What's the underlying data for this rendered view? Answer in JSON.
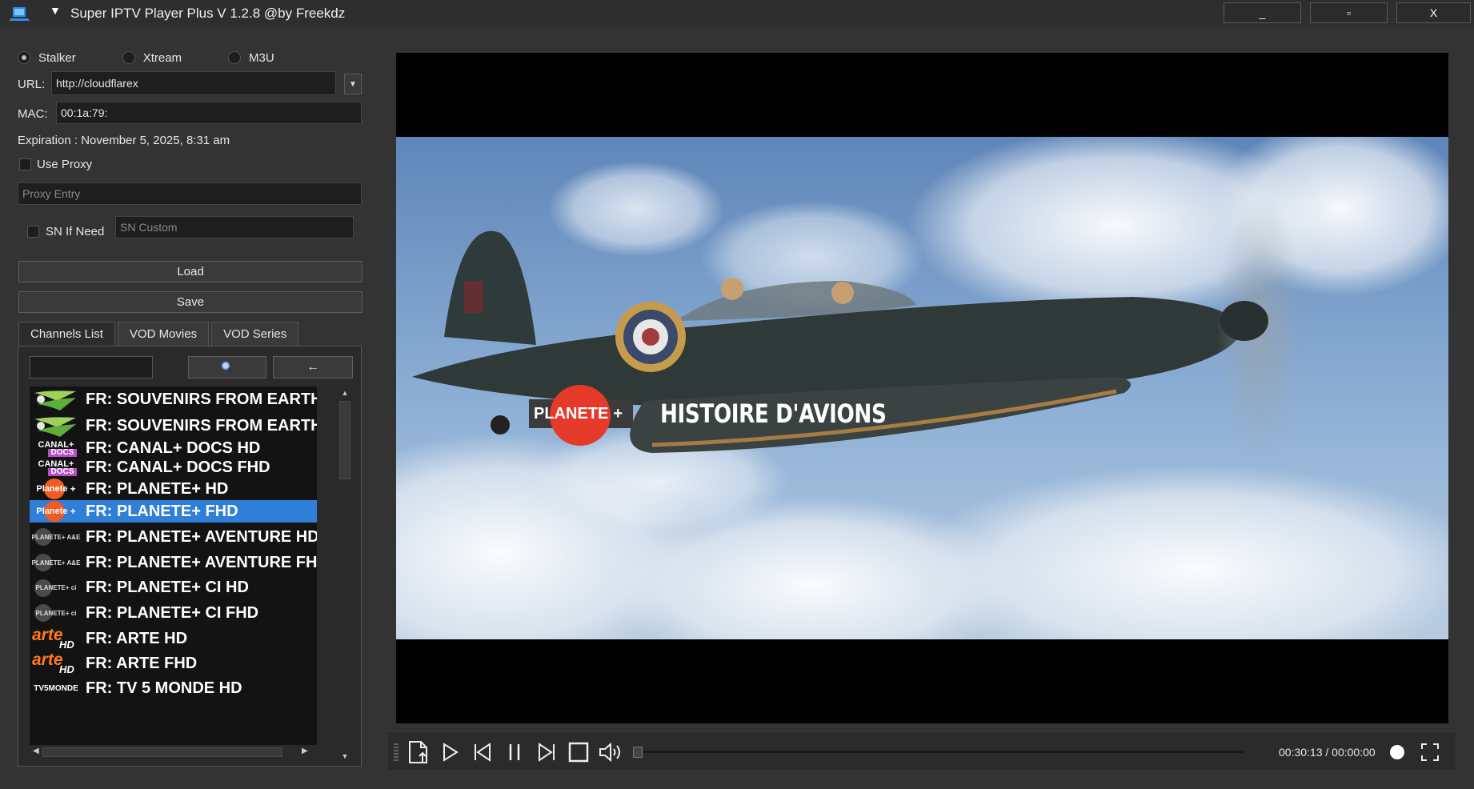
{
  "window": {
    "title": "Super IPTV Player Plus V 1.2.8 @by Freekdz",
    "minimize_label": "_",
    "maximize_label": "▫",
    "close_label": "X",
    "menu_icon": "menu-caret-icon",
    "app_icon": "laptop-icon"
  },
  "mode": {
    "options": [
      "Stalker",
      "Xtream",
      "M3U"
    ],
    "selected": "Stalker"
  },
  "connection": {
    "url_label": "URL:",
    "url_value": "http://cloudflarex",
    "mac_label": "MAC:",
    "mac_value": "00:1a:79:",
    "expiration": "Expiration : November 5, 2025, 8:31 am",
    "use_proxy_label": "Use Proxy",
    "proxy_placeholder": "Proxy Entry",
    "sn_label": "SN If Need",
    "sn_placeholder": "SN Custom"
  },
  "actions": {
    "load_label": "Load",
    "save_label": "Save"
  },
  "tabs": [
    "Channels List",
    "VOD Movies",
    "VOD Series"
  ],
  "active_tab": "Channels List",
  "list_controls": {
    "search_icon": "magnifier-icon",
    "back_label": "←"
  },
  "channels": [
    {
      "name": "FR: SOUVENIRS FROM EARTH HD",
      "logo": "souvenirs-from-earth-logo"
    },
    {
      "name": "FR: SOUVENIRS FROM EARTH FHD",
      "logo": "souvenirs-from-earth-logo"
    },
    {
      "name": "FR: CANAL+ DOCS HD",
      "logo": "canal-docs-logo",
      "logo_text": "CANAL+",
      "logo_sub": "DOCS"
    },
    {
      "name": "FR: CANAL+ DOCS FHD",
      "logo": "canal-docs-logo",
      "logo_text": "CANAL+",
      "logo_sub": "DOCS"
    },
    {
      "name": "FR: PLANETE+ HD",
      "logo": "planete-logo",
      "logo_text": "Planete",
      "logo_plus": "+"
    },
    {
      "name": "FR: PLANETE+ FHD",
      "logo": "planete-logo",
      "logo_text": "Planete",
      "logo_plus": "+",
      "selected": true
    },
    {
      "name": "FR: PLANETE+ AVENTURE HD",
      "logo": "planete-aventure-logo",
      "logo_text": "PLANETE+ A&E"
    },
    {
      "name": "FR: PLANETE+ AVENTURE FHD",
      "logo": "planete-aventure-logo",
      "logo_text": "PLANETE+ A&E"
    },
    {
      "name": "FR: PLANETE+ CI HD",
      "logo": "planete-ci-logo",
      "logo_text": "PLANETE+ ci"
    },
    {
      "name": "FR: PLANETE+ CI FHD",
      "logo": "planete-ci-logo",
      "logo_text": "PLANETE+ ci"
    },
    {
      "name": "FR: ARTE HD",
      "logo": "arte-hd-logo",
      "logo_text": "arte",
      "logo_sub": "HD"
    },
    {
      "name": "FR: ARTE FHD",
      "logo": "arte-hd-logo",
      "logo_text": "arte",
      "logo_sub": "HD"
    },
    {
      "name": "FR: TV 5 MONDE HD",
      "logo": "tv5monde-logo",
      "logo_text": "TV5MONDE"
    }
  ],
  "video": {
    "overlay_channel": "PLANETE",
    "overlay_plus": "+",
    "overlay_title": "HISTOIRE D'AVIONS"
  },
  "player": {
    "time": "00:30:13 / 00:00:00",
    "controls": [
      "open-file-icon",
      "play-icon",
      "skip-previous-icon",
      "pause-icon",
      "skip-next-icon",
      "stop-icon",
      "volume-icon",
      "fullscreen-icon"
    ]
  },
  "colors": {
    "background": "#333333",
    "selection": "#2f7ed8",
    "planete_red": "#e53a2a"
  }
}
